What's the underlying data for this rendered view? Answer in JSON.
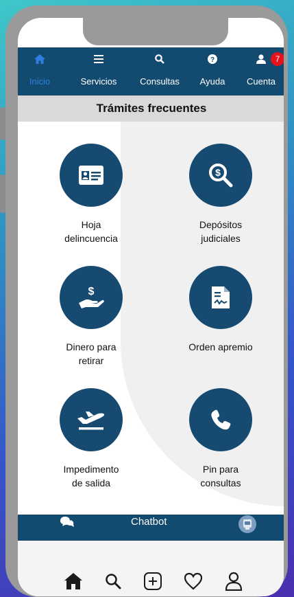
{
  "nav": {
    "items": [
      {
        "label": "Inicio",
        "icon": "home-icon",
        "active": true
      },
      {
        "label": "Servicios",
        "icon": "menu-icon"
      },
      {
        "label": "Consultas",
        "icon": "search-icon"
      },
      {
        "label": "Ayuda",
        "icon": "help-icon"
      },
      {
        "label": "Cuenta",
        "icon": "user-icon"
      }
    ],
    "badge": "7"
  },
  "section": {
    "title": "Trámites frecuentes"
  },
  "tiles": [
    {
      "line1": "Hoja",
      "line2": "delincuencia",
      "icon": "id-card-icon"
    },
    {
      "line1": "Depósitos",
      "line2": "judiciales",
      "icon": "money-search-icon"
    },
    {
      "line1": "Dinero para",
      "line2": "retirar",
      "icon": "hand-money-icon"
    },
    {
      "line1": "Orden apremio",
      "line2": "",
      "icon": "document-icon"
    },
    {
      "line1": "Impedimento",
      "line2": "de salida",
      "icon": "airplane-icon"
    },
    {
      "line1": "Pin para",
      "line2": "consultas",
      "icon": "phone-icon"
    }
  ],
  "chatbot": {
    "label": "Chatbot"
  },
  "bottom_nav": [
    "home-icon",
    "search-icon",
    "add-icon",
    "heart-icon",
    "profile-icon"
  ],
  "colors": {
    "navy": "#134a70",
    "active": "#2f7fe0",
    "badge": "#e5121b"
  }
}
